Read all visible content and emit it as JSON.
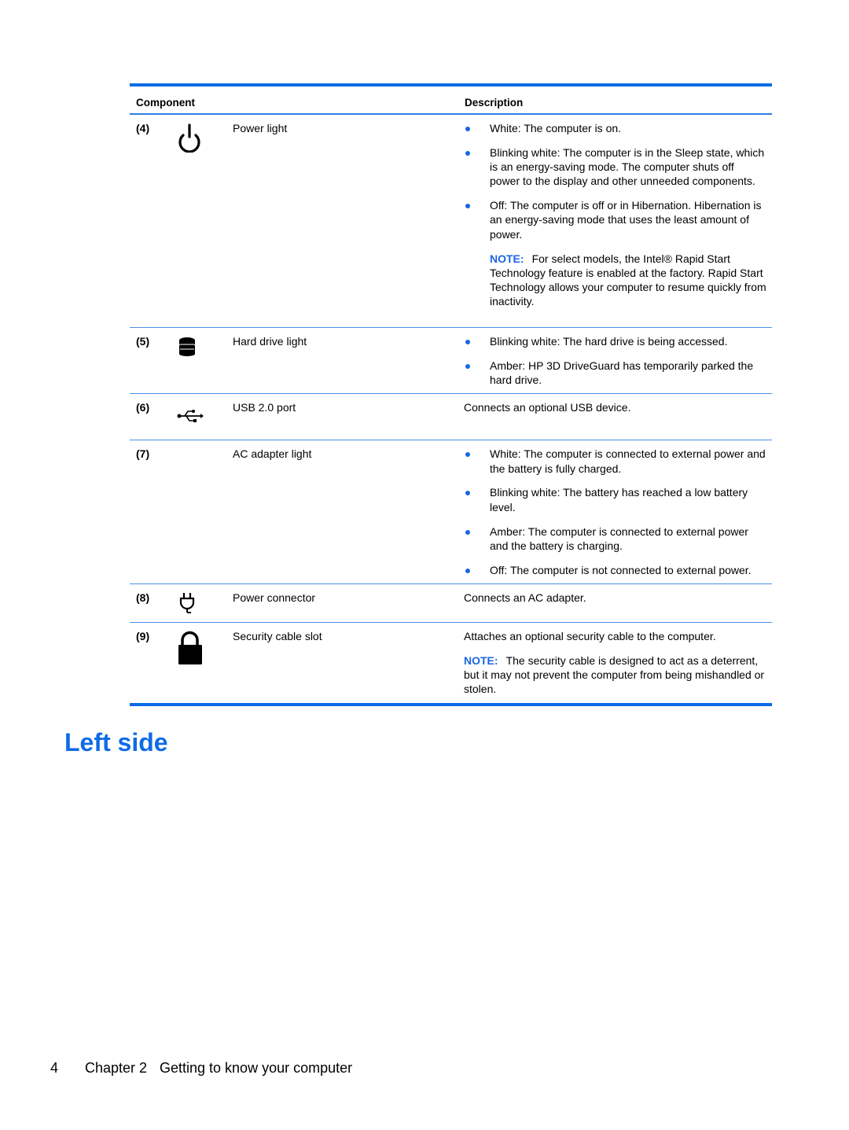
{
  "table": {
    "headers": {
      "component": "Component",
      "description": "Description"
    },
    "rows": [
      {
        "num": "(4)",
        "icon": "power-icon",
        "name": "Power light",
        "bullets": [
          "White: The computer is on.",
          "Blinking white: The computer is in the Sleep state, which is an energy-saving mode. The computer shuts off power to the display and other unneeded components.",
          "Off: The computer is off or in Hibernation. Hibernation is an energy-saving mode that uses the least amount of power."
        ],
        "note": {
          "label": "NOTE:",
          "text": "For select models, the Intel® Rapid Start Technology feature is enabled at the factory. Rapid Start Technology allows your computer to resume quickly from inactivity."
        }
      },
      {
        "num": "(5)",
        "icon": "hard-drive-icon",
        "name": "Hard drive light",
        "bullets": [
          "Blinking white: The hard drive is being accessed.",
          "Amber: HP 3D DriveGuard has temporarily parked the hard drive."
        ]
      },
      {
        "num": "(6)",
        "icon": "usb-icon",
        "name": "USB 2.0 port",
        "text": "Connects an optional USB device."
      },
      {
        "num": "(7)",
        "icon": "",
        "name": "AC adapter light",
        "bullets": [
          "White: The computer is connected to external power and the battery is fully charged.",
          "Blinking white: The battery has reached a low battery level.",
          "Amber: The computer is connected to external power and the battery is charging.",
          "Off: The computer is not connected to external power."
        ]
      },
      {
        "num": "(8)",
        "icon": "power-plug-icon",
        "name": "Power connector",
        "text": "Connects an AC adapter."
      },
      {
        "num": "(9)",
        "icon": "lock-icon",
        "name": "Security cable slot",
        "text": "Attaches an optional security cable to the computer.",
        "note": {
          "label": "NOTE:",
          "text": "The security cable is designed to act as a deterrent, but it may not prevent the computer from being mishandled or stolen."
        }
      }
    ]
  },
  "section_heading": "Left side",
  "footer": {
    "page_number": "4",
    "chapter": "Chapter 2",
    "chapter_title": "Getting to know your computer"
  },
  "colors": {
    "accent": "#0f6be6",
    "rule": "#0a6ae6"
  }
}
